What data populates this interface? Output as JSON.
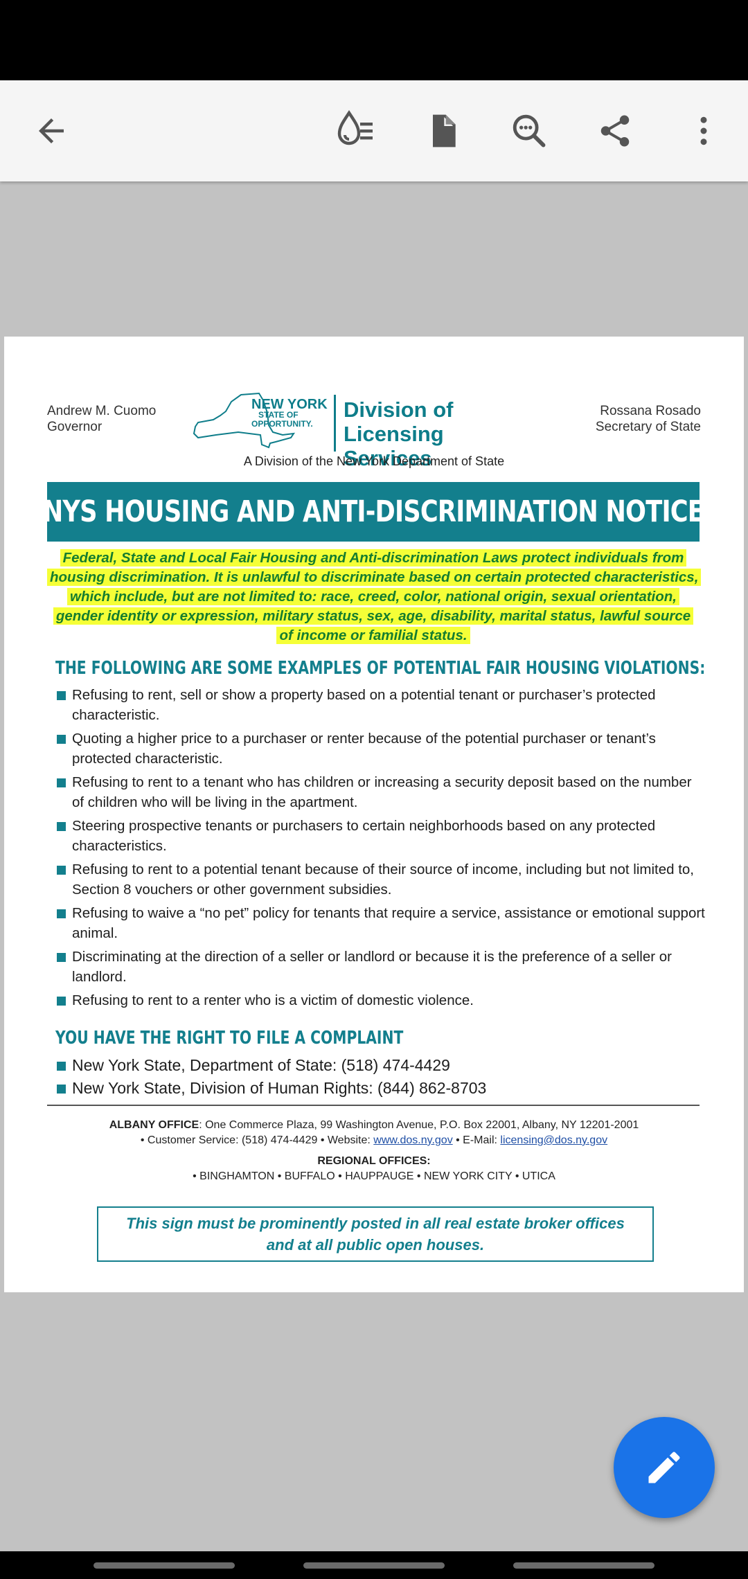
{
  "toolbar": {
    "back_icon": "arrow-back-icon",
    "reading_mode_icon": "reading-mode-icon",
    "document_icon": "document-icon",
    "search_icon": "search-icon",
    "share_icon": "share-icon",
    "more_icon": "more-vert-icon"
  },
  "document": {
    "governor_name": "Andrew M. Cuomo",
    "governor_title": "Governor",
    "secretary_name": "Rossana Rosado",
    "secretary_title": "Secretary of State",
    "logo": {
      "ny_line1": "NEW YORK",
      "ny_line2": "STATE OF",
      "ny_line3": "OPPORTUNITY.",
      "division_line1": "Division of",
      "division_line2": "Licensing Services"
    },
    "subtitle": "A Division of the New York Department of State",
    "banner_title": "NYS HOUSING AND ANTI-DISCRIMINATION NOTICE",
    "intro_part1": "Federal, State and Local Fair Housing and Anti-discrimination Laws protect individuals from housing discrimination. ",
    "intro_part2": "It is unlawful",
    "intro_part3": " to discriminate based on certain protected characteristics, which include, but are not limited to: ",
    "intro_part4": "race, creed, color, national origin, sexual orientation, gender identity or expression, military status, sex, age, disability, marital status, lawful source of income or familial status.",
    "violations_title": "THE FOLLOWING ARE SOME EXAMPLES OF POTENTIAL FAIR HOUSING VIOLATIONS:",
    "violations": [
      "Refusing to rent, sell or show a property based on a potential tenant or purchaser’s protected characteristic.",
      "Quoting a higher price to a purchaser or renter because of the potential purchaser or tenant’s protected characteristic.",
      "Refusing to rent to a tenant who has children or increasing a security deposit based on the number of children who will be living in the apartment.",
      "Steering prospective tenants or purchasers to certain neighborhoods based on any protected characteristics.",
      "Refusing to rent to a potential tenant because of their source of income, including but not limited to, Section 8 vouchers or other government subsidies.",
      "Refusing to waive a “no pet” policy for tenants that require a service, assistance or emotional support animal.",
      "Discriminating at the direction of a seller or landlord or because it is the preference of a seller or landlord.",
      "Refusing to rent to a renter who is a victim of domestic violence."
    ],
    "complaint_title": "YOU HAVE THE RIGHT TO FILE A COMPLAINT",
    "complaints": [
      "New York State, Department of State: (518) 474-4429",
      "New York State, Division of Human Rights: (844) 862-8703"
    ],
    "footer": {
      "albany_label": "ALBANY OFFICE",
      "albany_address": ": One Commerce Plaza, 99 Washington Avenue, P.O. Box 22001, Albany, NY 12201-2001",
      "customer_service": "• Customer Service: (518) 474-4429  • Website: ",
      "website": "www.dos.ny.gov",
      "email_label": "  • E-Mail: ",
      "email": "licensing@dos.ny.gov",
      "regional_label": "REGIONAL OFFICES:",
      "regional_list": "• BINGHAMTON • BUFFALO • HAUPPAUGE • NEW YORK CITY • UTICA"
    },
    "notice_line1": "This sign must be prominently posted in all real estate broker offices",
    "notice_line2": "and at all public open houses."
  },
  "fab": {
    "icon": "edit-pencil-icon"
  },
  "colors": {
    "accent_teal": "#137f8d",
    "highlight_yellow": "#f5ff37",
    "intro_green": "#157d2e",
    "fab_blue": "#1a73e8"
  }
}
